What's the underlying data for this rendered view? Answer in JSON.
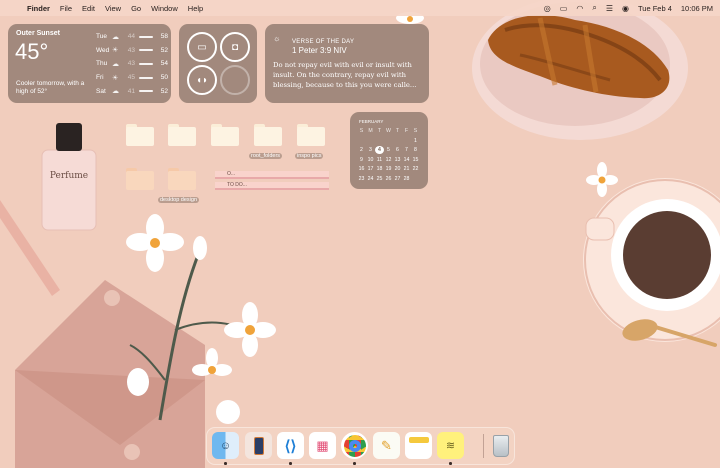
{
  "menubar": {
    "apple": "",
    "app": "Finder",
    "items": [
      "File",
      "Edit",
      "View",
      "Go",
      "Window",
      "Help"
    ],
    "date": "Tue Feb 4",
    "time": "10:06 PM"
  },
  "weather": {
    "city": "Outer Sunset",
    "temp": "45°",
    "note": "Cooler tomorrow, with a high of 52°",
    "days": [
      {
        "day": "Tue",
        "lo": "44",
        "hi": "58",
        "icon": "☁"
      },
      {
        "day": "Wed",
        "lo": "43",
        "hi": "52",
        "icon": "☀"
      },
      {
        "day": "Thu",
        "lo": "43",
        "hi": "54",
        "icon": "☁"
      },
      {
        "day": "Fri",
        "lo": "45",
        "hi": "50",
        "icon": "☀"
      },
      {
        "day": "Sat",
        "lo": "41",
        "hi": "52",
        "icon": "☁"
      }
    ]
  },
  "verse": {
    "title": "VERSE OF THE DAY",
    "ref": "1 Peter 3:9 NIV",
    "text": "Do not repay evil with evil or insult with insult. On the contrary, repay evil with blessing, because to this you were calle..."
  },
  "calendar": {
    "month": "FEBRUARY",
    "weekdays": [
      "S",
      "M",
      "T",
      "W",
      "T",
      "F",
      "S"
    ],
    "days": [
      "",
      "",
      "",
      "",
      "",
      "",
      "1",
      "2",
      "3",
      "4",
      "5",
      "6",
      "7",
      "8",
      "9",
      "10",
      "11",
      "12",
      "13",
      "14",
      "15",
      "16",
      "17",
      "18",
      "19",
      "20",
      "21",
      "22",
      "23",
      "24",
      "25",
      "26",
      "27",
      "28",
      ""
    ],
    "today": "4"
  },
  "desktop": {
    "folders": [
      "",
      "",
      "",
      "root_folders",
      "inspo pics",
      "",
      "desktop design"
    ],
    "notes": [
      "O...",
      "TO DO..."
    ]
  },
  "decor": {
    "perfume_label": "Perfume"
  }
}
